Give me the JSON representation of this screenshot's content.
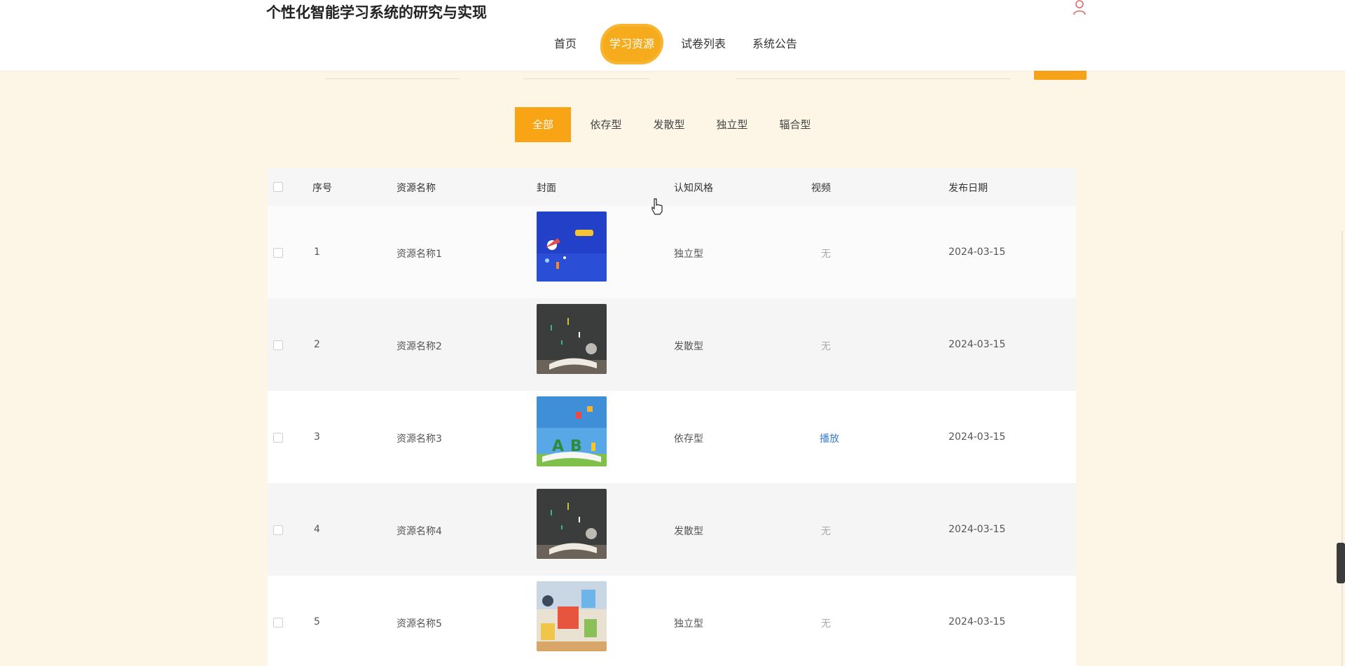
{
  "header": {
    "site_title": "个性化智能学习系统的研究与实现",
    "nav": [
      {
        "label": "首页"
      },
      {
        "label": "学习资源"
      },
      {
        "label": "试卷列表"
      },
      {
        "label": "系统公告"
      }
    ],
    "active_nav": "学习资源"
  },
  "filters": {
    "tabs": [
      {
        "label": "全部"
      },
      {
        "label": "依存型"
      },
      {
        "label": "发散型"
      },
      {
        "label": "独立型"
      },
      {
        "label": "辐合型"
      }
    ],
    "active": "全部"
  },
  "table": {
    "columns": [
      "序号",
      "资源名称",
      "封面",
      "认知风格",
      "视频",
      "发布日期"
    ],
    "rows": [
      {
        "index": "1",
        "name": "资源名称1",
        "cover": "space-rocket-illustration",
        "style": "独立型",
        "video": "无",
        "date": "2024-03-15"
      },
      {
        "index": "2",
        "name": "资源名称2",
        "cover": "book-chalkboard-photo",
        "style": "发散型",
        "video": "无",
        "date": "2024-03-15"
      },
      {
        "index": "3",
        "name": "资源名称3",
        "cover": "abc-book-illustration",
        "style": "依存型",
        "video": "播放",
        "date": "2024-03-15"
      },
      {
        "index": "4",
        "name": "资源名称4",
        "cover": "book-chalkboard-photo",
        "style": "发散型",
        "video": "无",
        "date": "2024-03-15"
      },
      {
        "index": "5",
        "name": "资源名称5",
        "cover": "classroom-illustration",
        "style": "独立型",
        "video": "无",
        "date": "2024-03-15"
      }
    ]
  },
  "colors": {
    "accent": "#f8a414",
    "page_background": "#fdf6e6",
    "link": "#3a7bd5"
  },
  "icons": {
    "user": "user-icon",
    "pointer": "hand-pointer-icon"
  }
}
